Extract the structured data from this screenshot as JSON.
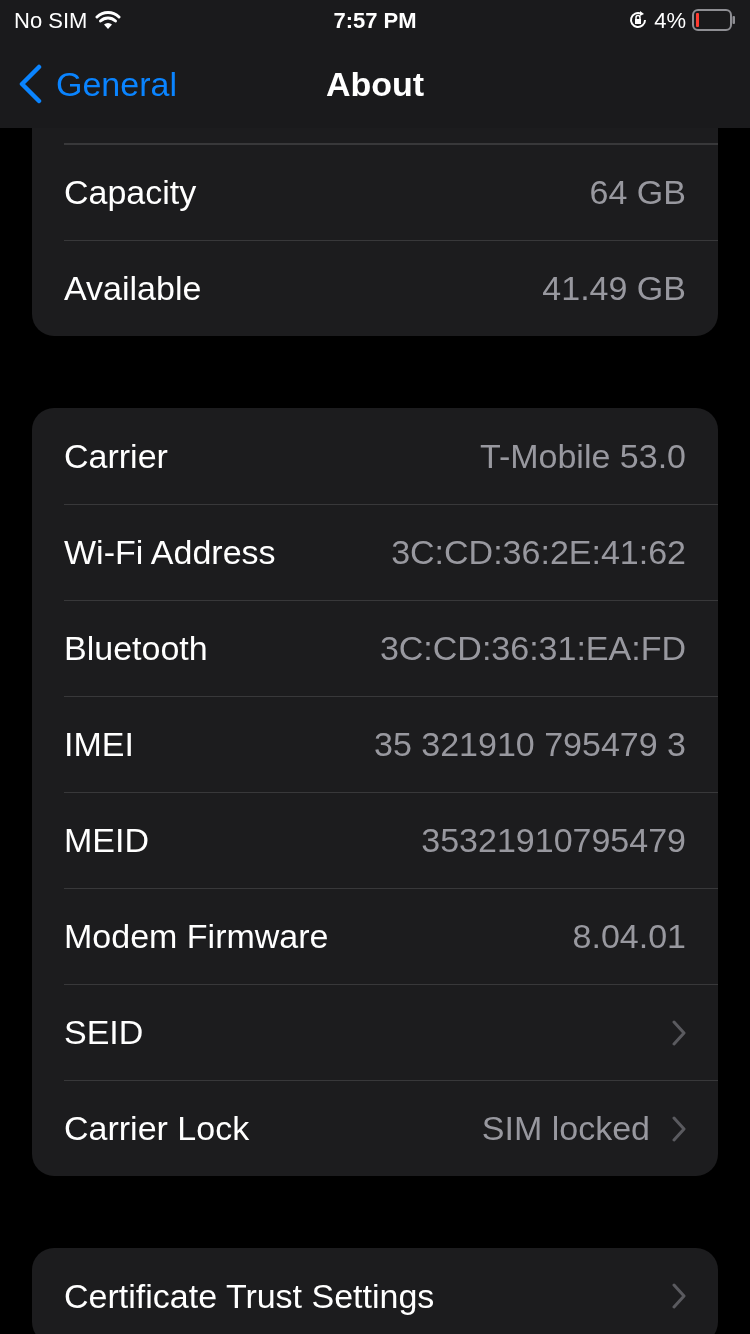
{
  "status_bar": {
    "carrier": "No SIM",
    "time": "7:57 PM",
    "battery": "4%"
  },
  "nav": {
    "back": "General",
    "title": "About"
  },
  "groups": [
    {
      "cut_top": true,
      "rows": [
        {
          "kind": "info",
          "label": "Capacity",
          "value": "64 GB"
        },
        {
          "kind": "info",
          "label": "Available",
          "value": "41.49 GB"
        }
      ]
    },
    {
      "rows": [
        {
          "kind": "info",
          "label": "Carrier",
          "value": "T-Mobile 53.0"
        },
        {
          "kind": "info",
          "label": "Wi-Fi Address",
          "value": "3C:CD:36:2E:41:62"
        },
        {
          "kind": "info",
          "label": "Bluetooth",
          "value": "3C:CD:36:31:EA:FD"
        },
        {
          "kind": "info",
          "label": "IMEI",
          "value": "35 321910 795479 3"
        },
        {
          "kind": "info",
          "label": "MEID",
          "value": "35321910795479"
        },
        {
          "kind": "info",
          "label": "Modem Firmware",
          "value": "8.04.01"
        },
        {
          "kind": "link",
          "label": "SEID"
        },
        {
          "kind": "link",
          "label": "Carrier Lock",
          "value": "SIM locked"
        }
      ]
    },
    {
      "rows": [
        {
          "kind": "link",
          "label": "Certificate Trust Settings"
        }
      ]
    }
  ]
}
